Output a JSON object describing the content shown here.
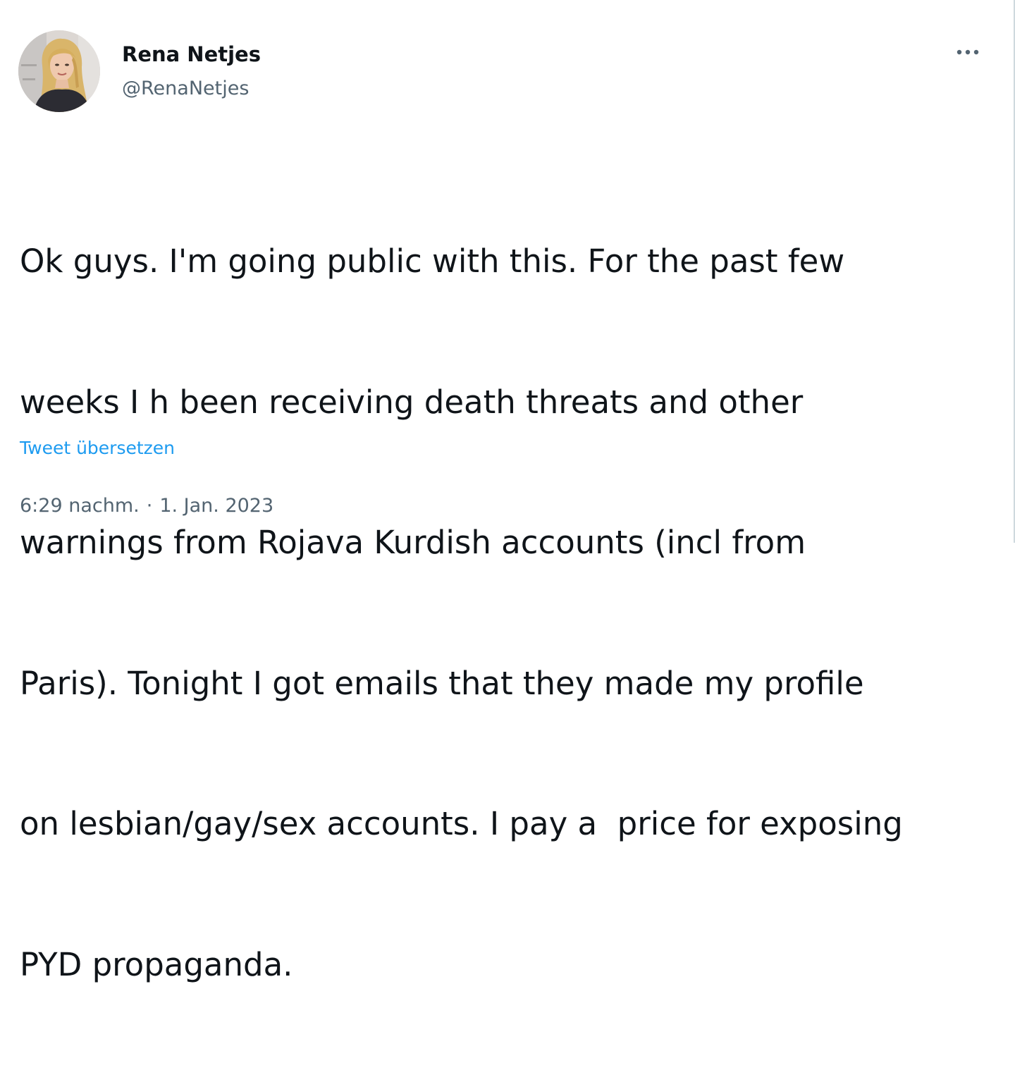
{
  "author": {
    "display_name": "Rena Netjes",
    "handle": "@RenaNetjes",
    "avatar_icon": "profile-photo"
  },
  "tweet": {
    "text_lines": [
      "Ok guys. I'm going public with this. For the past few",
      "weeks I h been receiving death threats and other",
      "warnings from Rojava Kurdish accounts (incl from",
      "Paris). Tonight I got emails that they made my profile",
      "on lesbian/gay/sex accounts. I pay a  price for exposing",
      "PYD propaganda."
    ],
    "translate_label": "Tweet übersetzen",
    "time": "6:29 nachm.",
    "separator": "·",
    "date": "1. Jan. 2023"
  },
  "more_icon": "more-horizontal-icon",
  "colors": {
    "text": "#0f1419",
    "secondary": "#536471",
    "link": "#1d9bf0"
  }
}
